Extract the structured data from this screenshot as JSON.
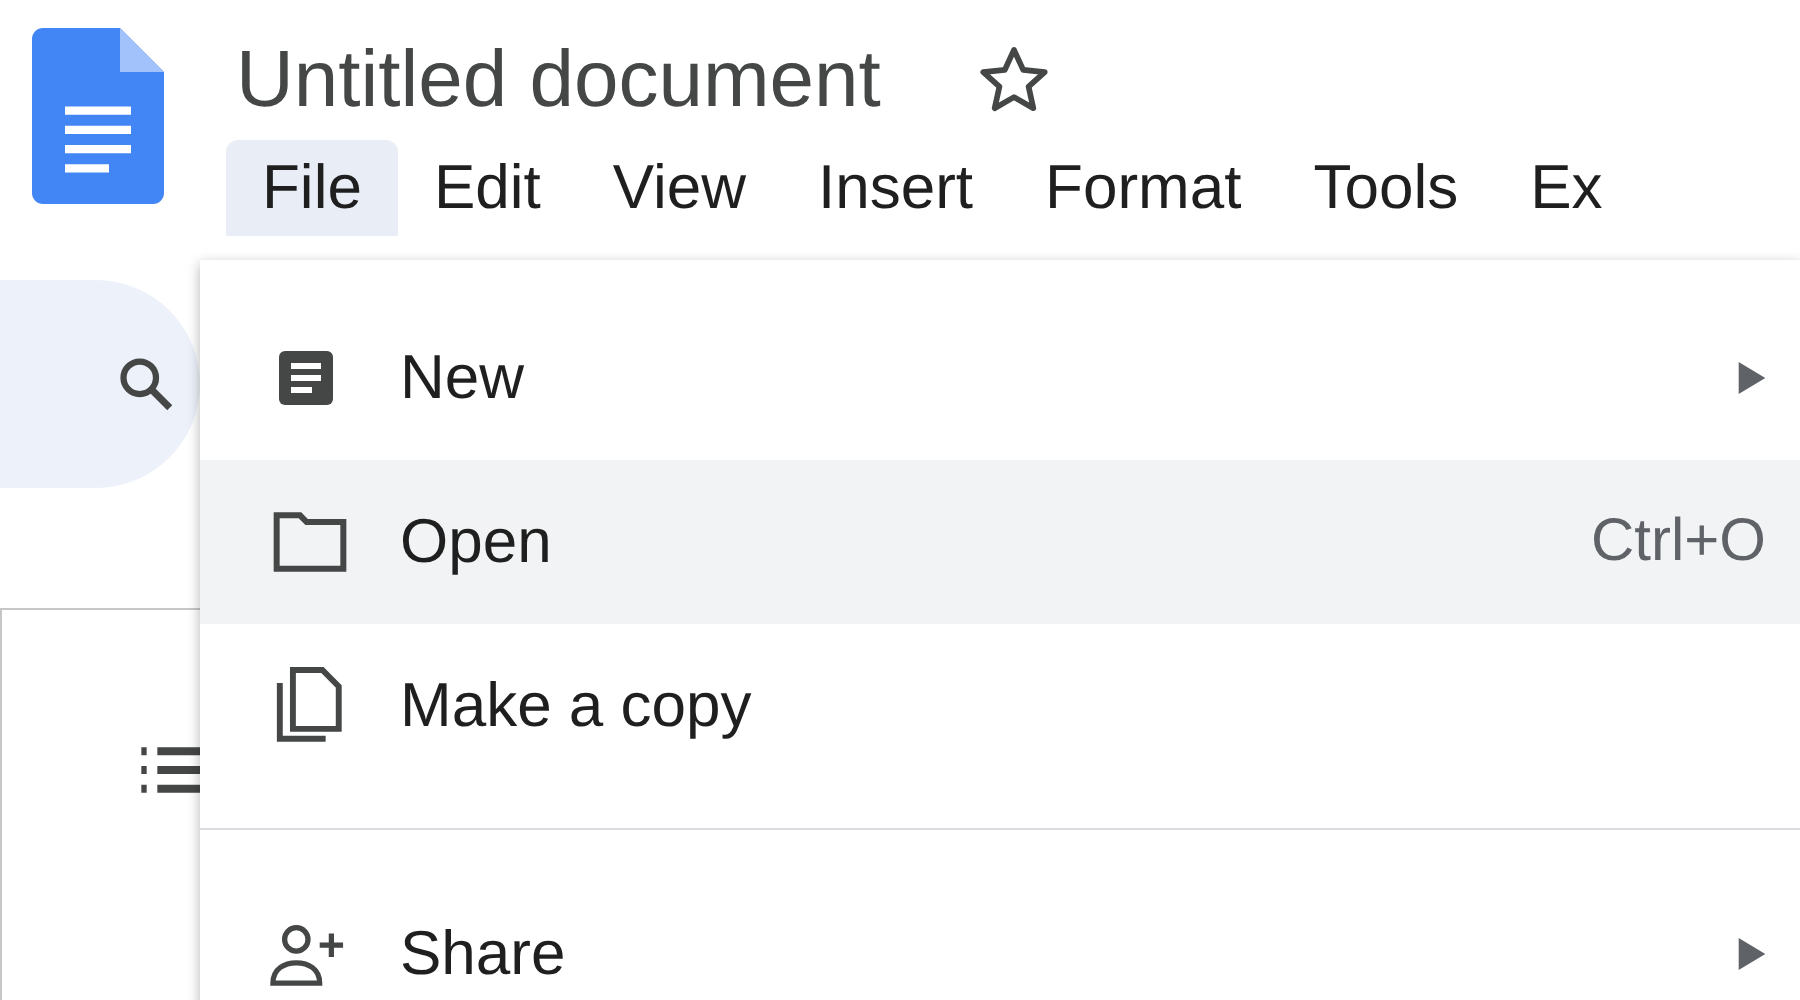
{
  "document": {
    "title": "Untitled document",
    "starred": false
  },
  "menu_bar": [
    {
      "label": "File",
      "selected": true
    },
    {
      "label": "Edit",
      "selected": false
    },
    {
      "label": "View",
      "selected": false
    },
    {
      "label": "Insert",
      "selected": false
    },
    {
      "label": "Format",
      "selected": false
    },
    {
      "label": "Tools",
      "selected": false
    },
    {
      "label": "Ex",
      "selected": false
    }
  ],
  "file_menu": [
    {
      "kind": "item",
      "label": "New",
      "submenu": true,
      "highlighted": false
    },
    {
      "kind": "item",
      "label": "Open",
      "shortcut": "Ctrl+O",
      "submenu": false,
      "highlighted": true
    },
    {
      "kind": "item",
      "label": "Make a copy",
      "submenu": false,
      "highlighted": false
    },
    {
      "kind": "divider"
    },
    {
      "kind": "item",
      "label": "Share",
      "submenu": true,
      "highlighted": false
    }
  ]
}
